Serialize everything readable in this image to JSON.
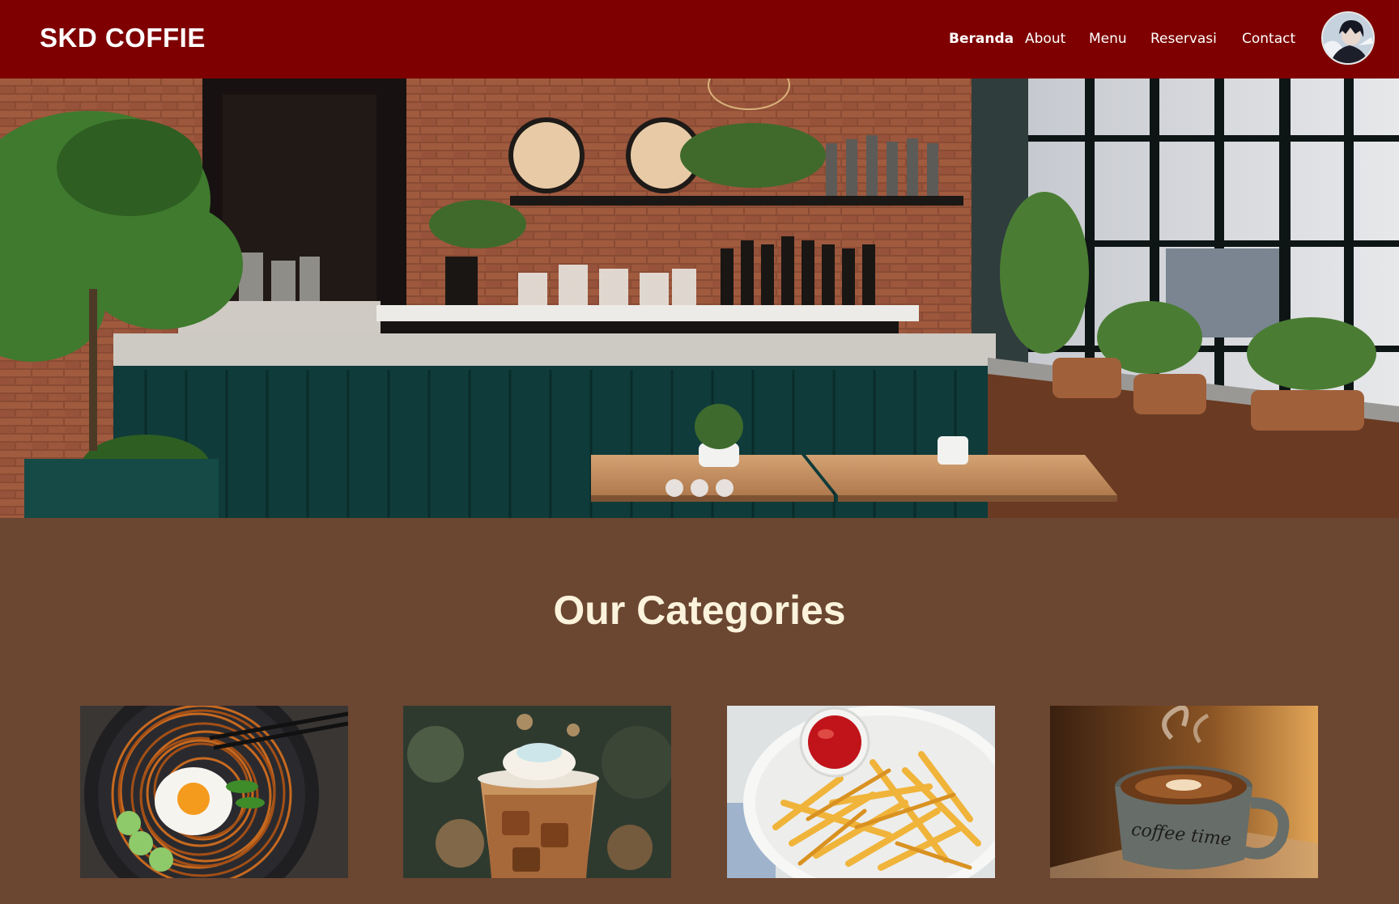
{
  "brand": {
    "name": "SKD COFFIE"
  },
  "nav": {
    "items": [
      {
        "label": "Beranda",
        "active": true
      },
      {
        "label": "About",
        "active": false
      },
      {
        "label": "Menu",
        "active": false
      },
      {
        "label": "Reservasi",
        "active": false
      },
      {
        "label": "Contact",
        "active": false
      }
    ]
  },
  "hero": {
    "slide_count": 3,
    "active_slide": 1
  },
  "categories": {
    "title": "Our Categories",
    "items": [
      {
        "image": "fried-noodles-with-egg"
      },
      {
        "image": "iced-caramel-coffee"
      },
      {
        "image": "french-fries-with-ketchup"
      },
      {
        "image": "hot-coffee-cup",
        "cup_text": "coffee time"
      }
    ]
  },
  "colors": {
    "navbar": "#7e0000",
    "body_bg": "#6b4631",
    "title_text": "#fbf3dc",
    "nav_text": "#ffffff"
  }
}
